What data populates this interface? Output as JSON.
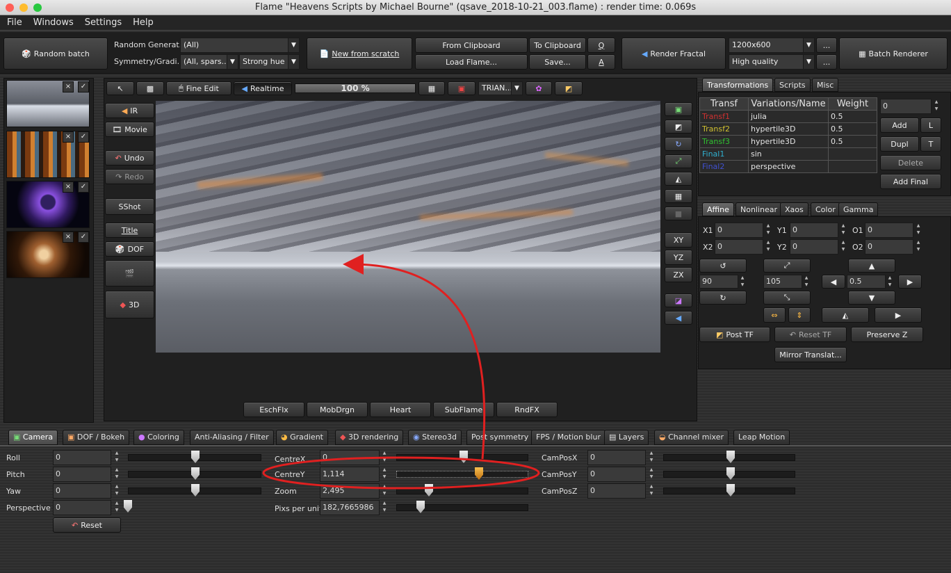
{
  "window": {
    "title": "Flame \"Heavens Scripts by Michael Bourne\" (qsave_2018-10-21_003.flame) : render time: 0.069s"
  },
  "menu": [
    "File",
    "Windows",
    "Settings",
    "Help"
  ],
  "toolbar": {
    "random_batch": "Random batch",
    "random_generator_label": "Random Generat...",
    "random_generator_value": "(All)",
    "symmetry_label": "Symmetry/Gradi...",
    "symmetry_value": "(All, spars...",
    "hue_value": "Strong hue",
    "new_from_scratch": "New from scratch",
    "from_clipboard": "From Clipboard",
    "load_flame": "Load Flame...",
    "to_clipboard": "To Clipboard",
    "save": "Save...",
    "q_btn": "Q",
    "a_btn": "A",
    "render_fractal": "Render Fractal",
    "resolution": "1200x600",
    "quality": "High quality",
    "dots": "...",
    "batch_renderer": "Batch Renderer"
  },
  "preview_toolbar": {
    "fine_edit": "Fine Edit",
    "realtime": "Realtime",
    "progress_text": "100 %",
    "progress_value": 100,
    "shape_combo": "TRIAN..."
  },
  "left_buttons": {
    "ir": "IR",
    "movie": "Movie",
    "undo": "Undo",
    "redo": "Redo",
    "sshot": "SShot",
    "title": "Title",
    "dof": "DOF",
    "three_d": "3D"
  },
  "axis_buttons": [
    "XY",
    "YZ",
    "ZX"
  ],
  "bottom_scripts": [
    "EschFlx",
    "MobDrgn",
    "Heart",
    "SubFlame",
    "RndFX"
  ],
  "right_tabs": [
    "Transformations",
    "Scripts",
    "Misc"
  ],
  "transforms": {
    "headers": [
      "Transf",
      "Variations/Name",
      "Weight"
    ],
    "rows": [
      {
        "name": "Transf1",
        "variation": "julia",
        "weight": "0.5",
        "color": "#d03030"
      },
      {
        "name": "Transf2",
        "variation": "hypertile3D",
        "weight": "0.5",
        "color": "#d0c030"
      },
      {
        "name": "Transf3",
        "variation": "hypertile3D",
        "weight": "0.5",
        "color": "#30c030"
      },
      {
        "name": "Final1",
        "variation": "sin",
        "weight": "",
        "color": "#30b0d0"
      },
      {
        "name": "Final2",
        "variation": "perspective",
        "weight": "",
        "color": "#4050d0"
      }
    ],
    "weight_field": "0",
    "add": "Add",
    "l": "L",
    "dupl": "Dupl",
    "t": "T",
    "delete": "Delete",
    "add_final": "Add Final"
  },
  "affine_tabs": [
    "Affine",
    "Nonlinear",
    "Xaos",
    "Color",
    "Gamma"
  ],
  "affine": {
    "x1_label": "X1",
    "x1": "0",
    "y1_label": "Y1",
    "y1": "0",
    "o1_label": "O1",
    "o1": "0",
    "x2_label": "X2",
    "x2": "0",
    "y2_label": "Y2",
    "y2": "0",
    "o2_label": "O2",
    "o2": "0",
    "rotate": "90",
    "scale": "105",
    "move": "0.5",
    "post_tf": "Post TF",
    "reset_tf": "Reset TF",
    "preserve_z": "Preserve Z",
    "mirror": "Mirror Translat..."
  },
  "bottom_tabs": [
    "Camera",
    "DOF / Bokeh",
    "Coloring",
    "Anti-Aliasing / Filter",
    "Gradient",
    "3D rendering",
    "Stereo3d",
    "Post symmetry",
    "FPS / Motion blur",
    "Layers",
    "Channel mixer",
    "Leap Motion"
  ],
  "camera": {
    "roll_label": "Roll",
    "roll": "0",
    "pitch_label": "Pitch",
    "pitch": "0",
    "yaw_label": "Yaw",
    "yaw": "0",
    "perspective_label": "Perspective",
    "perspective": "0",
    "reset": "Reset",
    "centrex_label": "CentreX",
    "centrex": "0",
    "centrey_label": "CentreY",
    "centrey": "1,114",
    "zoom_label": "Zoom",
    "zoom": "2,495",
    "pixs_label": "Pixs per unit",
    "pixs": "182,7665986",
    "camposx_label": "CamPosX",
    "camposx": "0",
    "camposy_label": "CamPosY",
    "camposy": "0",
    "camposz_label": "CamPosZ",
    "camposz": "0"
  },
  "colors": {
    "annotation": "#e02020",
    "accent_orange": "#e09020"
  }
}
